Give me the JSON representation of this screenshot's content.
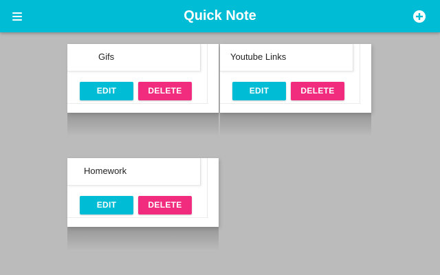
{
  "app": {
    "title": "Quick Note",
    "menu_icon": "hamburger-menu-icon",
    "add_icon": "add-circle-icon",
    "accent_color": "#00bcd4",
    "delete_color": "#f12c7f",
    "background_color": "#bbbbbb"
  },
  "notes": [
    {
      "title": "Gifs",
      "edit_label": "EDIT",
      "delete_label": "DELETE"
    },
    {
      "title": "Youtube Links",
      "edit_label": "EDIT",
      "delete_label": "DELETE"
    },
    {
      "title": "Homework",
      "edit_label": "EDIT",
      "delete_label": "DELETE"
    }
  ]
}
